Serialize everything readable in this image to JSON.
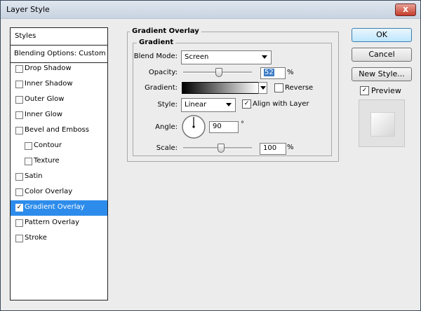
{
  "window": {
    "title": "Layer Style",
    "close_label": "x"
  },
  "sidebar": {
    "header": "Styles",
    "blending": "Blending Options: Custom",
    "items": [
      {
        "label": "Drop Shadow",
        "checked": false
      },
      {
        "label": "Inner Shadow",
        "checked": false
      },
      {
        "label": "Outer Glow",
        "checked": false
      },
      {
        "label": "Inner Glow",
        "checked": false
      },
      {
        "label": "Bevel and Emboss",
        "checked": false
      },
      {
        "label": "Contour",
        "checked": false
      },
      {
        "label": "Texture",
        "checked": false
      },
      {
        "label": "Satin",
        "checked": false
      },
      {
        "label": "Color Overlay",
        "checked": false
      },
      {
        "label": "Gradient Overlay",
        "checked": true
      },
      {
        "label": "Pattern Overlay",
        "checked": false
      },
      {
        "label": "Stroke",
        "checked": false
      }
    ],
    "check_glyph": "✓"
  },
  "panel": {
    "title": "Gradient Overlay",
    "group_title": "Gradient",
    "blend_mode": {
      "label": "Blend Mode:",
      "value": "Screen"
    },
    "opacity": {
      "label": "Opacity:",
      "value": "52",
      "unit": "%",
      "level": 52
    },
    "gradient": {
      "label": "Gradient:",
      "from_color": "#000000",
      "to_color": "#ffffff"
    },
    "reverse": {
      "label": "Reverse",
      "checked": false
    },
    "style": {
      "label": "Style:",
      "value": "Linear"
    },
    "align": {
      "label": "Align with Layer",
      "checked": true
    },
    "angle": {
      "label": "Angle:",
      "value": "90",
      "unit": "°"
    },
    "scale": {
      "label": "Scale:",
      "value": "100",
      "unit": "%",
      "level": 100
    }
  },
  "buttons": {
    "ok": "OK",
    "cancel": "Cancel",
    "new_style": "New Style..."
  },
  "preview": {
    "label": "Preview",
    "checked": true
  },
  "colors": {
    "selection": "#2d8ceb",
    "accent": "#3c7cc6"
  }
}
